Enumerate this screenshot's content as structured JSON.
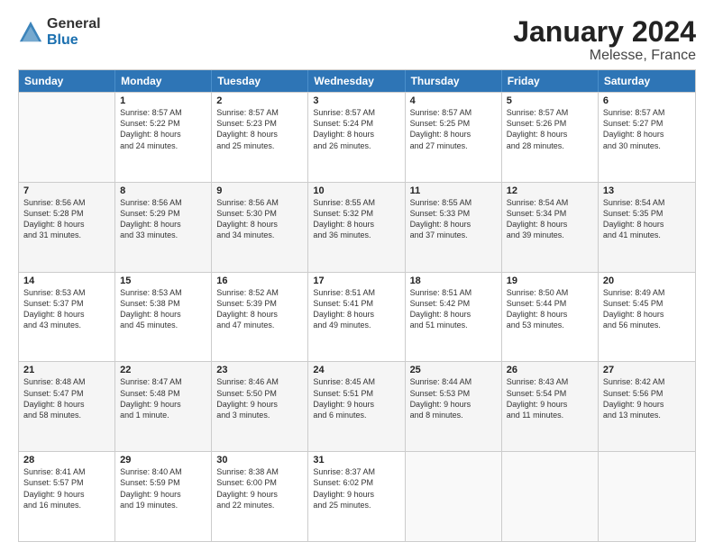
{
  "logo": {
    "general": "General",
    "blue": "Blue"
  },
  "header": {
    "title": "January 2024",
    "subtitle": "Melesse, France"
  },
  "calendar": {
    "days": [
      "Sunday",
      "Monday",
      "Tuesday",
      "Wednesday",
      "Thursday",
      "Friday",
      "Saturday"
    ],
    "rows": [
      [
        {
          "day": "",
          "info": ""
        },
        {
          "day": "1",
          "info": "Sunrise: 8:57 AM\nSunset: 5:22 PM\nDaylight: 8 hours\nand 24 minutes."
        },
        {
          "day": "2",
          "info": "Sunrise: 8:57 AM\nSunset: 5:23 PM\nDaylight: 8 hours\nand 25 minutes."
        },
        {
          "day": "3",
          "info": "Sunrise: 8:57 AM\nSunset: 5:24 PM\nDaylight: 8 hours\nand 26 minutes."
        },
        {
          "day": "4",
          "info": "Sunrise: 8:57 AM\nSunset: 5:25 PM\nDaylight: 8 hours\nand 27 minutes."
        },
        {
          "day": "5",
          "info": "Sunrise: 8:57 AM\nSunset: 5:26 PM\nDaylight: 8 hours\nand 28 minutes."
        },
        {
          "day": "6",
          "info": "Sunrise: 8:57 AM\nSunset: 5:27 PM\nDaylight: 8 hours\nand 30 minutes."
        }
      ],
      [
        {
          "day": "7",
          "info": "Sunrise: 8:56 AM\nSunset: 5:28 PM\nDaylight: 8 hours\nand 31 minutes."
        },
        {
          "day": "8",
          "info": "Sunrise: 8:56 AM\nSunset: 5:29 PM\nDaylight: 8 hours\nand 33 minutes."
        },
        {
          "day": "9",
          "info": "Sunrise: 8:56 AM\nSunset: 5:30 PM\nDaylight: 8 hours\nand 34 minutes."
        },
        {
          "day": "10",
          "info": "Sunrise: 8:55 AM\nSunset: 5:32 PM\nDaylight: 8 hours\nand 36 minutes."
        },
        {
          "day": "11",
          "info": "Sunrise: 8:55 AM\nSunset: 5:33 PM\nDaylight: 8 hours\nand 37 minutes."
        },
        {
          "day": "12",
          "info": "Sunrise: 8:54 AM\nSunset: 5:34 PM\nDaylight: 8 hours\nand 39 minutes."
        },
        {
          "day": "13",
          "info": "Sunrise: 8:54 AM\nSunset: 5:35 PM\nDaylight: 8 hours\nand 41 minutes."
        }
      ],
      [
        {
          "day": "14",
          "info": "Sunrise: 8:53 AM\nSunset: 5:37 PM\nDaylight: 8 hours\nand 43 minutes."
        },
        {
          "day": "15",
          "info": "Sunrise: 8:53 AM\nSunset: 5:38 PM\nDaylight: 8 hours\nand 45 minutes."
        },
        {
          "day": "16",
          "info": "Sunrise: 8:52 AM\nSunset: 5:39 PM\nDaylight: 8 hours\nand 47 minutes."
        },
        {
          "day": "17",
          "info": "Sunrise: 8:51 AM\nSunset: 5:41 PM\nDaylight: 8 hours\nand 49 minutes."
        },
        {
          "day": "18",
          "info": "Sunrise: 8:51 AM\nSunset: 5:42 PM\nDaylight: 8 hours\nand 51 minutes."
        },
        {
          "day": "19",
          "info": "Sunrise: 8:50 AM\nSunset: 5:44 PM\nDaylight: 8 hours\nand 53 minutes."
        },
        {
          "day": "20",
          "info": "Sunrise: 8:49 AM\nSunset: 5:45 PM\nDaylight: 8 hours\nand 56 minutes."
        }
      ],
      [
        {
          "day": "21",
          "info": "Sunrise: 8:48 AM\nSunset: 5:47 PM\nDaylight: 8 hours\nand 58 minutes."
        },
        {
          "day": "22",
          "info": "Sunrise: 8:47 AM\nSunset: 5:48 PM\nDaylight: 9 hours\nand 1 minute."
        },
        {
          "day": "23",
          "info": "Sunrise: 8:46 AM\nSunset: 5:50 PM\nDaylight: 9 hours\nand 3 minutes."
        },
        {
          "day": "24",
          "info": "Sunrise: 8:45 AM\nSunset: 5:51 PM\nDaylight: 9 hours\nand 6 minutes."
        },
        {
          "day": "25",
          "info": "Sunrise: 8:44 AM\nSunset: 5:53 PM\nDaylight: 9 hours\nand 8 minutes."
        },
        {
          "day": "26",
          "info": "Sunrise: 8:43 AM\nSunset: 5:54 PM\nDaylight: 9 hours\nand 11 minutes."
        },
        {
          "day": "27",
          "info": "Sunrise: 8:42 AM\nSunset: 5:56 PM\nDaylight: 9 hours\nand 13 minutes."
        }
      ],
      [
        {
          "day": "28",
          "info": "Sunrise: 8:41 AM\nSunset: 5:57 PM\nDaylight: 9 hours\nand 16 minutes."
        },
        {
          "day": "29",
          "info": "Sunrise: 8:40 AM\nSunset: 5:59 PM\nDaylight: 9 hours\nand 19 minutes."
        },
        {
          "day": "30",
          "info": "Sunrise: 8:38 AM\nSunset: 6:00 PM\nDaylight: 9 hours\nand 22 minutes."
        },
        {
          "day": "31",
          "info": "Sunrise: 8:37 AM\nSunset: 6:02 PM\nDaylight: 9 hours\nand 25 minutes."
        },
        {
          "day": "",
          "info": ""
        },
        {
          "day": "",
          "info": ""
        },
        {
          "day": "",
          "info": ""
        }
      ]
    ]
  }
}
